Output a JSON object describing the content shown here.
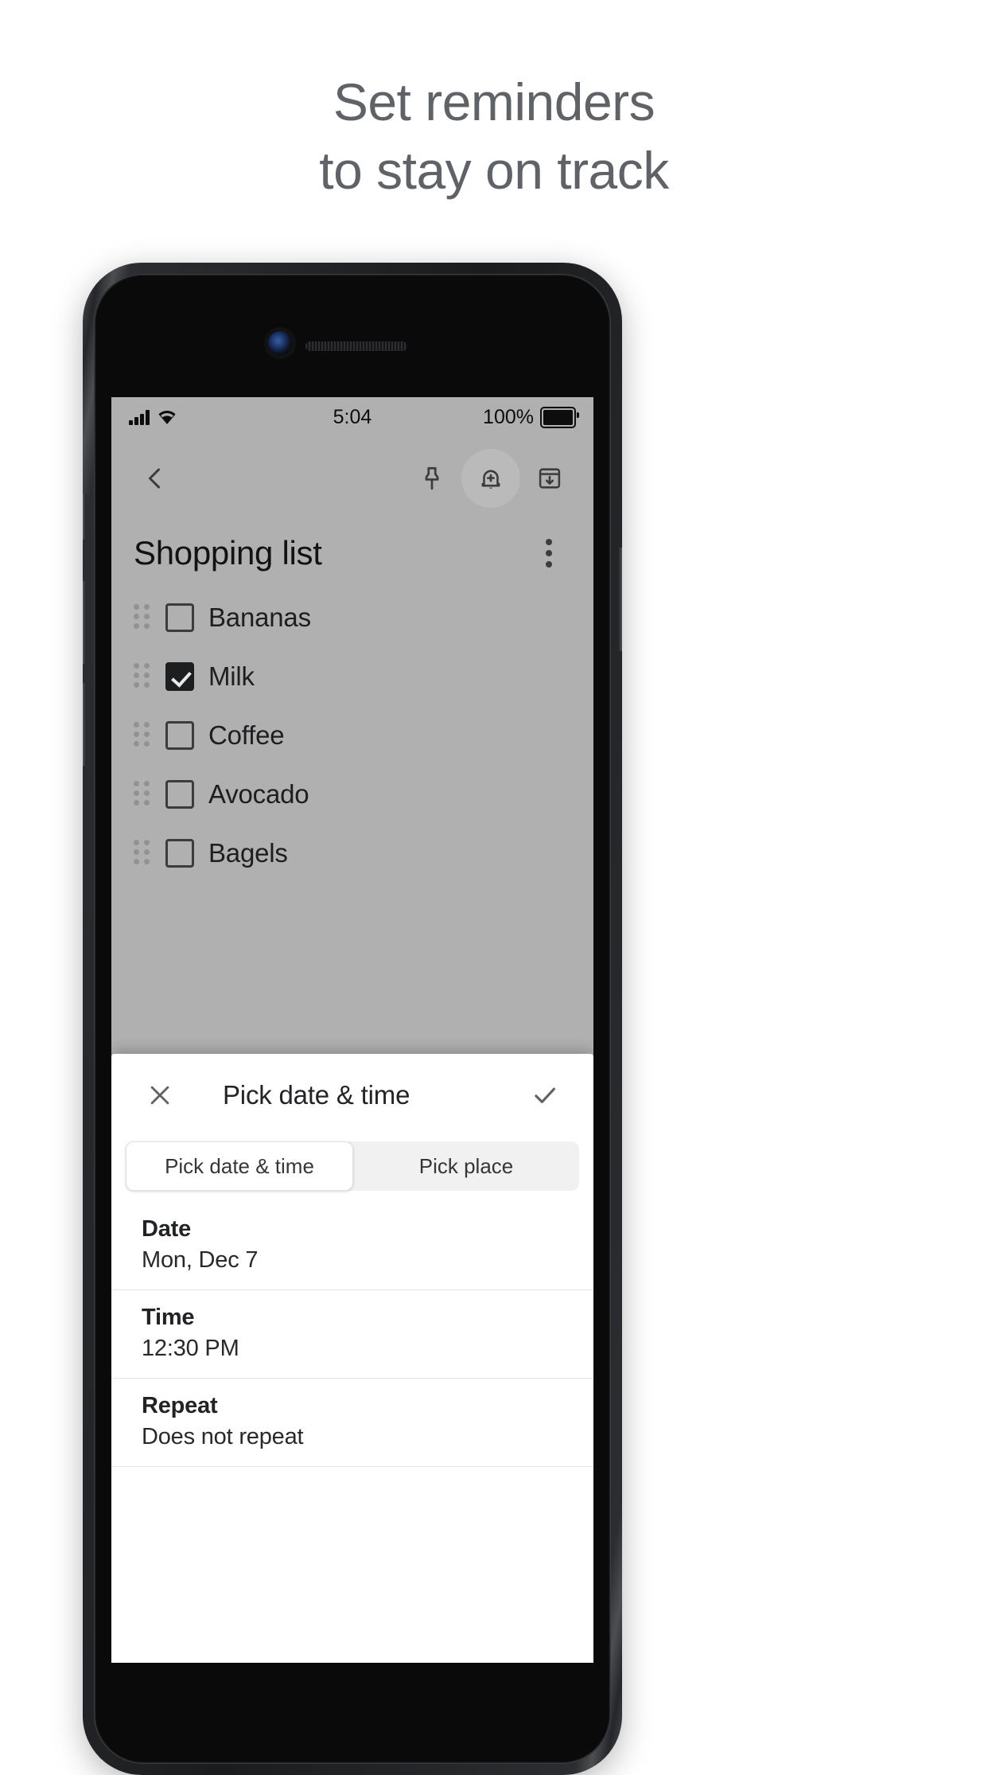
{
  "headline": {
    "line1": "Set reminders",
    "line2": "to stay on track",
    "color": "#5f6368"
  },
  "phone": {
    "status_bar": {
      "signal_icon": "cellular-signal-icon",
      "wifi_icon": "wifi-icon",
      "time": "5:04",
      "battery_percent": "100%",
      "battery_icon": "battery-full-icon"
    },
    "app_bar": {
      "back_icon": "back-arrow-icon",
      "pin_icon": "pin-icon",
      "reminder_icon": "bell-add-icon",
      "archive_icon": "archive-icon"
    },
    "note": {
      "title": "Shopping list",
      "overflow_icon": "more-vert-icon",
      "items": [
        {
          "label": "Bananas",
          "checked": false
        },
        {
          "label": "Milk",
          "checked": true
        },
        {
          "label": "Coffee",
          "checked": false
        },
        {
          "label": "Avocado",
          "checked": false
        },
        {
          "label": "Bagels",
          "checked": false
        }
      ]
    },
    "sheet": {
      "close_icon": "close-icon",
      "title": "Pick date & time",
      "confirm_icon": "check-icon",
      "tabs": [
        {
          "label": "Pick date & time",
          "active": true
        },
        {
          "label": "Pick place",
          "active": false
        }
      ],
      "rows": [
        {
          "label": "Date",
          "value": "Mon, Dec 7"
        },
        {
          "label": "Time",
          "value": "12:30 PM"
        },
        {
          "label": "Repeat",
          "value": "Does not repeat"
        }
      ]
    }
  }
}
